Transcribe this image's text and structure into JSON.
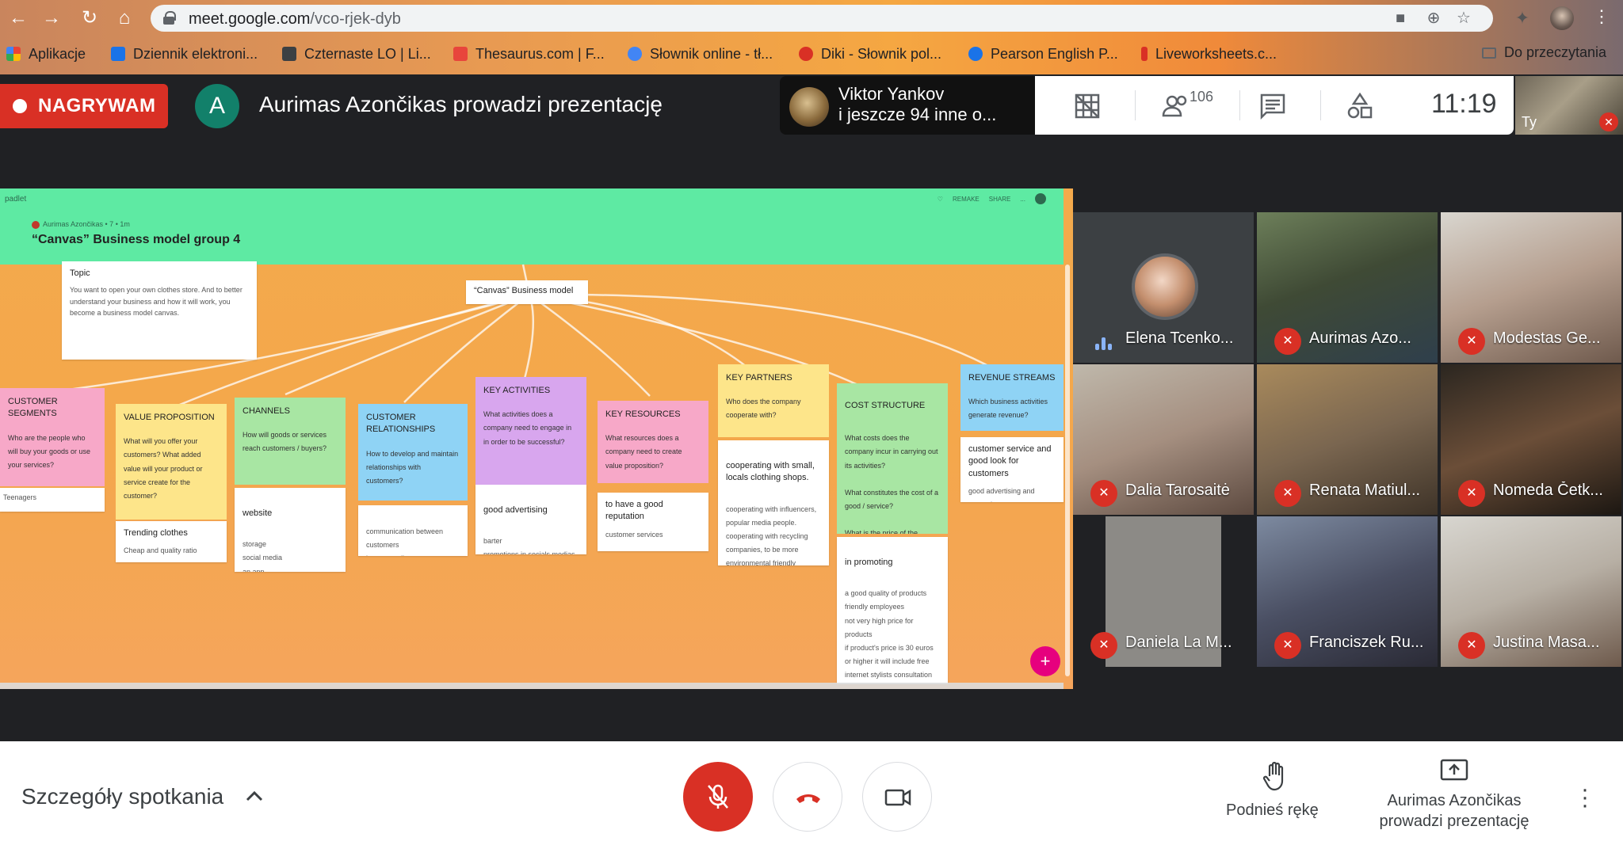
{
  "browser": {
    "url_host": "meet.google.com",
    "url_path": "/vco-rjek-dyb",
    "bookmarks": [
      {
        "label": "Aplikacje",
        "color": "#e8453c"
      },
      {
        "label": "Dziennik elektroni...",
        "color": "#1a73e8"
      },
      {
        "label": "Czternaste LO | Li...",
        "color": "#3c4043"
      },
      {
        "label": "Thesaurus.com | F...",
        "color": "#e8453c"
      },
      {
        "label": "Słownik online - tł...",
        "color": "#4285f4"
      },
      {
        "label": "Diki - Słownik pol...",
        "color": "#d93025"
      },
      {
        "label": "Pearson English P...",
        "color": "#1a73e8"
      },
      {
        "label": "Liveworksheets.c...",
        "color": "#d93025"
      }
    ],
    "reading_list": "Do przeczytania"
  },
  "meet": {
    "recording_label": "NAGRYWAM",
    "presenter_initial": "A",
    "presenter_text": "Aurimas Azončikas prowadzi prezentację",
    "people_chip_line1": "Viktor Yankov",
    "people_chip_line2": "i jeszcze 94 inne o...",
    "participant_count": "106",
    "clock": "11:19",
    "self_label": "Ty"
  },
  "padlet": {
    "logo": "padlet",
    "meta": "Aurimas Azončikas • 7 • 1m",
    "title": "“Canvas” Business model group 4",
    "actions": [
      "REMAKE",
      "SHARE",
      "..."
    ],
    "topic": {
      "title": "Topic",
      "text": "You want to open your own clothes store. And to better understand your business and how it will work, you become a business model canvas."
    },
    "center": "“Canvas” Business model",
    "columns": [
      {
        "header": "CUSTOMER SEGMENTS",
        "question": "Who are the people who will buy your goods or use your services?",
        "answers": [
          {
            "title": "Teenagers",
            "sub": ""
          }
        ]
      },
      {
        "header": "VALUE PROPOSITION",
        "question": "What will you offer your customers? What added value will your product or service create for the customer?",
        "answers": [
          {
            "title": "Trending clothes",
            "sub": "Cheap and quality ratio"
          }
        ]
      },
      {
        "header": "CHANNELS",
        "question": "How will goods or services reach customers / buyers?",
        "answers": [
          {
            "title": "website",
            "sub": "storage\nsocial media\nan app"
          }
        ]
      },
      {
        "header": "CUSTOMER RELATIONSHIPS",
        "question": "How to develop and maintain relationships with customers?",
        "answers": [
          {
            "title": "",
            "sub": "communication between customers\ninternet stylist"
          }
        ]
      },
      {
        "header": "KEY ACTIVITIES",
        "question": "What activities does a company need to engage in in order to be successful?",
        "answers": [
          {
            "title": "good advertising",
            "sub": "barter\npromotions in socials medias"
          }
        ]
      },
      {
        "header": "KEY RESOURCES",
        "question": "What resources does a company need to create value proposition?",
        "answers": [
          {
            "title": "to have a good reputation",
            "sub": "customer services"
          }
        ]
      },
      {
        "header": "KEY PARTNERS",
        "question": "Who does the company cooperate with?",
        "answers": [
          {
            "title": "cooperating with small, locals clothing shops.",
            "sub": "cooperating with influencers, popular media people.\ncooperating with recycling companies, to be more environmental friendly"
          }
        ]
      },
      {
        "header": "COST STRUCTURE",
        "question": "What costs does the company incur in carrying out its activities?\n\nWhat constitutes the cost of a good / service?\n\nWhat is the price of the product / service?",
        "answers": [
          {
            "title": "in promoting",
            "sub": "a good quality of products\nfriendly employees\nnot very high price for products\nif product's price is 30 euros or higher it will include free internet stylists consultation"
          }
        ]
      },
      {
        "header": "REVENUE STREAMS",
        "question": "Which business activities generate revenue?",
        "answers": [
          {
            "title": "customer service and good look for customers",
            "sub": "good advertising and promoting"
          }
        ]
      }
    ],
    "colors": {
      "header": "#5eeaa3",
      "pink": "#f7a8c8",
      "yellow": "#fde58a",
      "green": "#a8e6a3",
      "blue": "#8fd3f5",
      "purple": "#d8a6ee"
    },
    "add_button": "+"
  },
  "participants": [
    {
      "name": "Elena Tcenko...",
      "muted": false
    },
    {
      "name": "Aurimas Azo...",
      "muted": true
    },
    {
      "name": "Modestas Ge...",
      "muted": true
    },
    {
      "name": "Dalia Tarosaitė",
      "muted": true
    },
    {
      "name": "Renata Matiul...",
      "muted": true
    },
    {
      "name": "Nomeda Četk...",
      "muted": true
    },
    {
      "name": "Daniela La M...",
      "muted": true
    },
    {
      "name": "Franciszek Ru...",
      "muted": true
    },
    {
      "name": "Justina Masa...",
      "muted": true
    }
  ],
  "bottom": {
    "details": "Szczegóły spotkania",
    "raise_hand": "Podnieś rękę",
    "presenting_line1": "Aurimas Azončikas",
    "presenting_line2": "prowadzi prezentację"
  },
  "accent": {
    "red": "#d93025",
    "meet_green": "#12806a"
  }
}
